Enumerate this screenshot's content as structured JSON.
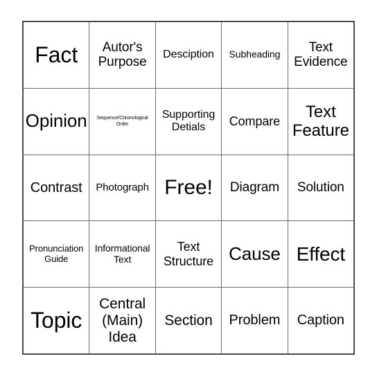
{
  "card": {
    "type": "bingo-card",
    "columns": 5,
    "rows": 5,
    "border_color": "#4a4a4a",
    "grid_line_color": "#6b6b6b",
    "background_color": "#ffffff",
    "text_color": "#000000",
    "free_space": {
      "row": 3,
      "column": 3,
      "label": "Free!"
    },
    "cells": [
      [
        {
          "label": "Fact",
          "size": "h4"
        },
        {
          "label": "Autor's\nPurpose",
          "size": "l"
        },
        {
          "label": "Desciption",
          "size": "m"
        },
        {
          "label": "Subheading",
          "size": "s"
        },
        {
          "label": "Text\nEvidence",
          "size": "l"
        }
      ],
      [
        {
          "label": "Opinion",
          "size": "h1"
        },
        {
          "label": "Sequence/Chronological\nOrder",
          "size": "xxs"
        },
        {
          "label": "Supporting\nDetials",
          "size": "m"
        },
        {
          "label": "Compare",
          "size": "ml"
        },
        {
          "label": "Text\nFeature",
          "size": "xxl"
        }
      ],
      [
        {
          "label": "Contrast",
          "size": "lg"
        },
        {
          "label": "Photograph",
          "size": "sm"
        },
        {
          "label": "Free!",
          "size": "h3"
        },
        {
          "label": "Diagram",
          "size": "l"
        },
        {
          "label": "Solution",
          "size": "l"
        }
      ],
      [
        {
          "label": "Pronunciation\nGuide",
          "size": "xs"
        },
        {
          "label": "Informational\nText",
          "size": "s"
        },
        {
          "label": "Text\nStructure",
          "size": "ml"
        },
        {
          "label": "Cause",
          "size": "h1"
        },
        {
          "label": "Effect",
          "size": "h2"
        }
      ],
      [
        {
          "label": "Topic",
          "size": "h4"
        },
        {
          "label": "Central\n(Main)\nIdea",
          "size": "xl"
        },
        {
          "label": "Section",
          "size": "xl"
        },
        {
          "label": "Problem",
          "size": "lg"
        },
        {
          "label": "Caption",
          "size": "lg"
        }
      ]
    ]
  }
}
